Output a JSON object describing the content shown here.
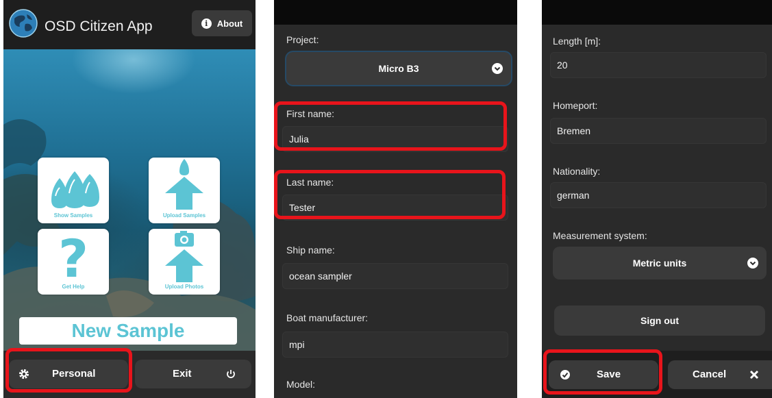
{
  "screen1": {
    "app_title": "OSD Citizen App",
    "about_label": "About",
    "tiles": {
      "show_samples": "Show Samples",
      "upload_samples": "Upload Samples",
      "get_help": "Get Help",
      "upload_photos": "Upload Photos"
    },
    "new_sample_label": "New Sample",
    "personal_label": "Personal",
    "exit_label": "Exit",
    "tile_color": "#5cc4d4",
    "highlight_color": "#e8141b"
  },
  "screen2": {
    "project_label": "Project:",
    "project_value": "Micro B3",
    "first_name_label": "First name:",
    "first_name_value": "Julia",
    "last_name_label": "Last name:",
    "last_name_value": "Tester",
    "ship_name_label": "Ship name:",
    "ship_name_value": "ocean sampler",
    "boat_manufacturer_label": "Boat manufacturer:",
    "boat_manufacturer_value": "mpi",
    "model_label": "Model:"
  },
  "screen3": {
    "length_label": "Length [m]:",
    "length_value": "20",
    "homeport_label": "Homeport:",
    "homeport_value": "Bremen",
    "nationality_label": "Nationality:",
    "nationality_value": "german",
    "measurement_label": "Measurement system:",
    "measurement_value": "Metric units",
    "sign_out_label": "Sign out",
    "save_label": "Save",
    "cancel_label": "Cancel"
  }
}
